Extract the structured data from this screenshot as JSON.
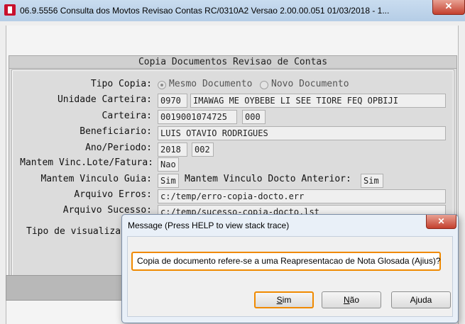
{
  "window": {
    "title": "06.9.5556 Consulta  dos Movtos Revisao Contas RC/0310A2 Versao 2.00.00.051 01/03/2018 - 1...",
    "close_glyph": "✕"
  },
  "panel": {
    "title": "Copia Documentos Revisao de Contas"
  },
  "form": {
    "tipo_copia": {
      "label": "Tipo Copia:",
      "options": [
        "Mesmo Documento",
        "Novo Documento"
      ],
      "selected": "Mesmo Documento"
    },
    "unidade_carteira": {
      "label": "Unidade Carteira:",
      "code": "0970",
      "name": "IMAWAG ME OYBEBE LI SEE TIORE FEQ OPBIJI"
    },
    "carteira": {
      "label": "Carteira:",
      "number": "0019001074725",
      "suffix": "000"
    },
    "beneficiario": {
      "label": "Beneficiario:",
      "value": "LUIS OTAVIO RODRIGUES"
    },
    "ano_periodo": {
      "label": "Ano/Periodo:",
      "ano": "2018",
      "periodo": "002"
    },
    "mantem_vinc_lote": {
      "label": "Mantem Vinc.Lote/Fatura:",
      "value": "Nao"
    },
    "mantem_vinculo_guia": {
      "label": "Mantem Vinculo Guia:",
      "value": "Sim"
    },
    "mantem_vinculo_docto": {
      "label": "Mantem Vinculo Docto Anterior:",
      "value": "Sim"
    },
    "arquivo_erros": {
      "label": "Arquivo Erros:",
      "value": "c:/temp/erro-copia-docto.err"
    },
    "arquivo_sucesso": {
      "label": "Arquivo Sucesso:",
      "value": "c:/temp/sucesso-copia-docto.lst"
    },
    "tipo_visualizacao": {
      "label": "Tipo de visualiza"
    }
  },
  "dialog": {
    "title": "Message (Press HELP to view stack trace)",
    "message": "Copia de documento refere-se a uma Reapresentacao de Nota Glosada (Ajius)?",
    "close_glyph": "✕",
    "buttons": {
      "sim_u": "S",
      "sim_rest": "im",
      "nao_u": "N",
      "nao_rest": "ão",
      "ajuda": "Ajuda"
    }
  }
}
